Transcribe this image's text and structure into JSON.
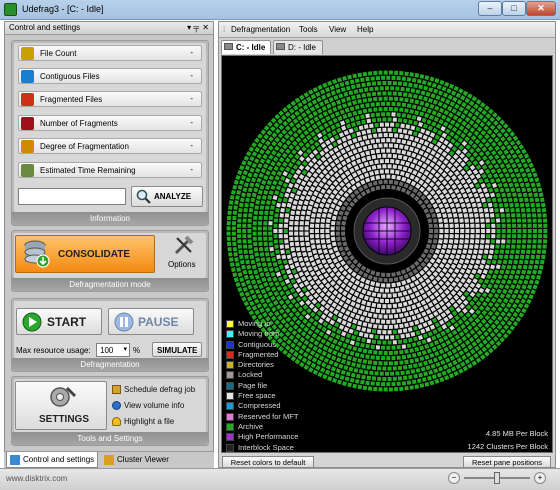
{
  "window": {
    "title": "Udefrag3 - [C: - Idle]",
    "minimize": "–",
    "maximize": "□",
    "close": "✕"
  },
  "left_panel": {
    "header": "Control and settings",
    "pin": "▾ ╤",
    "close": "✕",
    "stats": [
      {
        "label": "File Count",
        "value": "-",
        "icon": "file-count-icon",
        "color": "#c9a000"
      },
      {
        "label": "Contiguous Files",
        "value": "-",
        "icon": "contiguous-files-icon",
        "color": "#1a7fd0"
      },
      {
        "label": "Fragmented Files",
        "value": "-",
        "icon": "fragmented-files-icon",
        "color": "#d0301a"
      },
      {
        "label": "Number of Fragments",
        "value": "-",
        "icon": "fragments-icon",
        "color": "#a0101a"
      },
      {
        "label": "Degree of Fragmentation",
        "value": "-",
        "icon": "degree-icon",
        "color": "#d08a00"
      },
      {
        "label": "Estimated Time Remaining",
        "value": "-",
        "icon": "clock-icon",
        "color": "#6a8a40"
      }
    ],
    "analyze_label": "ANALYZE",
    "info_caption": "Information",
    "consolidate_label": "CONSOLIDATE",
    "options_label": "Options",
    "mode_caption": "Defragmentation mode",
    "start_label": "START",
    "pause_label": "PAUSE",
    "max_resource_label": "Max resource usage:",
    "max_resource_value": "100",
    "percent": "%",
    "simulate_label": "SIMULATE",
    "defrag_caption": "Defragmentation",
    "settings_label": "SETTINGS",
    "links": [
      "Schedule defrag job",
      "View volume info",
      "Highlight a file"
    ],
    "tools_caption": "Tools and Settings",
    "tabs": [
      "Control and settings",
      "Cluster Viewer"
    ]
  },
  "status_url": "www.disktrix.com",
  "menu": [
    "Defragmentation",
    "Tools",
    "View",
    "Help"
  ],
  "doc_tabs": [
    "C: - Idle",
    "D: - Idle"
  ],
  "legend": [
    {
      "label": "Moving to",
      "color": "#ffff33"
    },
    {
      "label": "Moving from",
      "color": "#33ffff"
    },
    {
      "label": "Contiguous",
      "color": "#1f2fe0"
    },
    {
      "label": "Fragmented",
      "color": "#e02a1a"
    },
    {
      "label": "Directories",
      "color": "#c9b21a"
    },
    {
      "label": "Locked",
      "color": "#9a9a9a"
    },
    {
      "label": "Page file",
      "color": "#0f6e88"
    },
    {
      "label": "Free space",
      "color": "#e6e6e6"
    },
    {
      "label": "Compressed",
      "color": "#1a9ad8"
    },
    {
      "label": "Reserved for MFT",
      "color": "#e07ad8"
    },
    {
      "label": "Archive",
      "color": "#22aa22"
    },
    {
      "label": "High Performance",
      "color": "#a030d0"
    },
    {
      "label": "Interblock Space",
      "color": "#202020"
    }
  ],
  "mb_per_block": "4.85 MB Per Block",
  "clusters_per_block": "1242 Clusters Per Block",
  "reset_colors": "Reset colors to default",
  "reset_pane": "Reset pane positions",
  "colors": {
    "archive": "#22aa22",
    "free": "#d9d9d9",
    "hub": "#a030d0"
  }
}
